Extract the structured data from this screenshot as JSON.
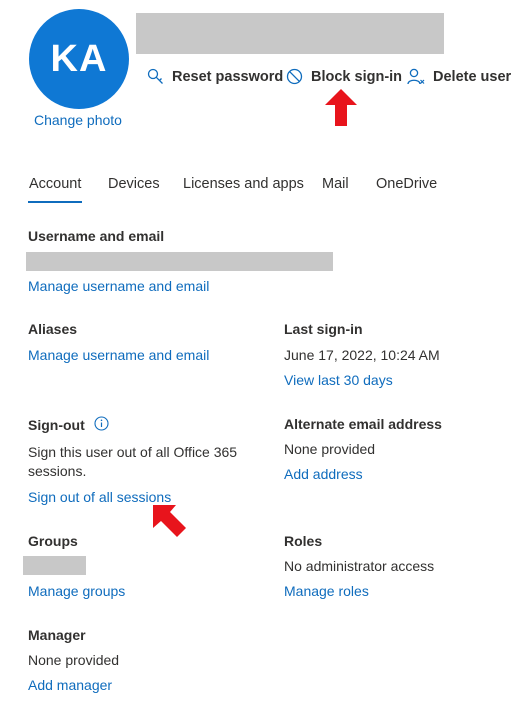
{
  "profile": {
    "initials": "KA",
    "change_photo": "Change photo",
    "avatar_color": "#0f78d4"
  },
  "actions": {
    "reset_password": {
      "label": "Reset password",
      "icon": "key-icon"
    },
    "block_signin": {
      "label": "Block sign-in",
      "icon": "block-icon"
    },
    "delete_user": {
      "label": "Delete user",
      "icon": "delete-user-icon"
    }
  },
  "tabs": [
    {
      "label": "Account",
      "active": true
    },
    {
      "label": "Devices",
      "active": false
    },
    {
      "label": "Licenses and apps",
      "active": false
    },
    {
      "label": "Mail",
      "active": false
    },
    {
      "label": "OneDrive",
      "active": false
    }
  ],
  "sections": {
    "username": {
      "heading": "Username and email",
      "link": "Manage username and email"
    },
    "aliases": {
      "heading": "Aliases",
      "link": "Manage username and email"
    },
    "last_signin": {
      "heading": "Last sign-in",
      "value": "June 17, 2022, 10:24 AM",
      "link": "View last 30 days"
    },
    "signout": {
      "heading": "Sign-out",
      "description": "Sign this user out of all Office 365 sessions.",
      "link": "Sign out of all sessions",
      "info_icon": "info-icon"
    },
    "alternate_email": {
      "heading": "Alternate email address",
      "value": "None provided",
      "link": "Add address"
    },
    "groups": {
      "heading": "Groups",
      "link": "Manage groups"
    },
    "roles": {
      "heading": "Roles",
      "value": "No administrator access",
      "link": "Manage roles"
    },
    "manager": {
      "heading": "Manager",
      "value": "None provided",
      "link": "Add manager"
    }
  },
  "colors": {
    "link": "#0f6cbd",
    "accent": "#0f78d4",
    "annotation_arrow": "#e8141c",
    "redaction": "#c8c8c8"
  }
}
